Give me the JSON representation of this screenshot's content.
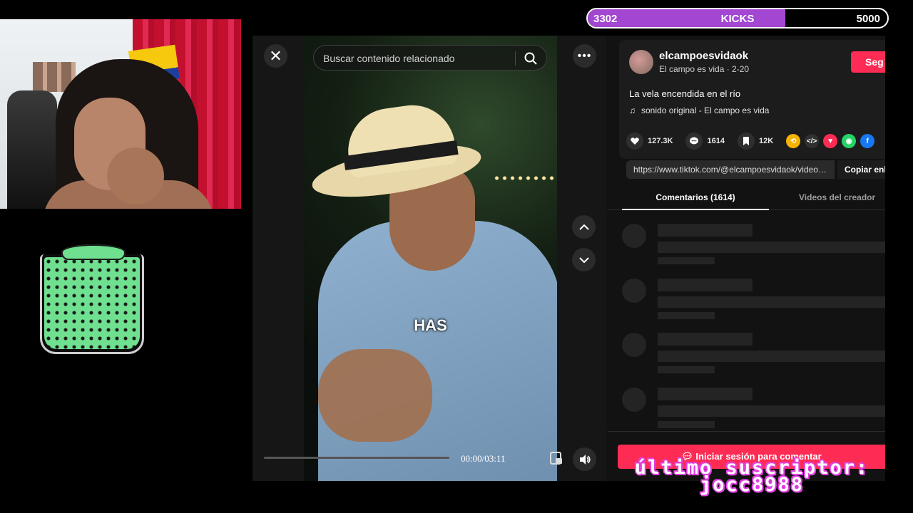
{
  "kicks_goal": {
    "current": "3302",
    "label": "KICKS",
    "target": "5000",
    "progress_fraction": 0.6604,
    "fill_color": "#a347d2"
  },
  "tiktok": {
    "search": {
      "placeholder": "Buscar contenido relacionado"
    },
    "video": {
      "subtitle": "HAS",
      "time": "00:00/03:11",
      "progress_fraction": 0
    },
    "author": {
      "username": "elcampoesvidaok",
      "subline": "El campo es vida · 2-20",
      "follow_label": "Seg"
    },
    "description": "La vela encendida en el río",
    "music": "sonido original - El campo es vida",
    "stats": {
      "likes": "127.3K",
      "comments": "1614",
      "saves": "12K"
    },
    "share_icons": [
      "repost-icon",
      "embed-icon",
      "send-icon",
      "whatsapp-icon",
      "facebook-icon"
    ],
    "link": {
      "url": "https://www.tiktok.com/@elcampoesvidaok/video/...",
      "copy_label": "Copiar enl"
    },
    "tabs": {
      "comments": "Comentarios (1614)",
      "creator": "Videos del creador"
    },
    "login_comment": "Iniciar sesión para comentar",
    "accent": "#fe2c55"
  },
  "overlay": {
    "last_sub_label": "último suscriptor:",
    "last_sub_name": "jocc8988"
  }
}
